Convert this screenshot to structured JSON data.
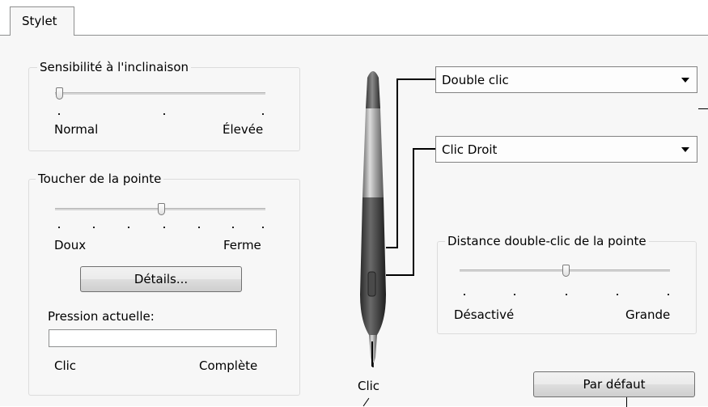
{
  "tab": {
    "label": "Stylet"
  },
  "tilt": {
    "title": "Sensibilité à l'inclinaison",
    "min_label": "Normal",
    "max_label": "Élevée",
    "value": 0.0
  },
  "tip": {
    "title": "Toucher de la pointe",
    "min_label": "Doux",
    "max_label": "Ferme",
    "value": 0.5,
    "details_button": "Détails...",
    "pressure_label": "Pression actuelle:",
    "pressure_value": 0.0,
    "click_label": "Clic",
    "full_label": "Complète"
  },
  "upper_button": {
    "value": "Double clic"
  },
  "lower_button": {
    "value": "Clic Droit"
  },
  "double_click": {
    "title": "Distance double-clic de la pointe",
    "min_label": "Désactivé",
    "max_label": "Grande",
    "value": 0.5
  },
  "pen_tip_label": "Clic",
  "default_button": "Par défaut",
  "icons": {
    "pen": "pen-icon",
    "dropdown": "chevron-down-icon"
  }
}
